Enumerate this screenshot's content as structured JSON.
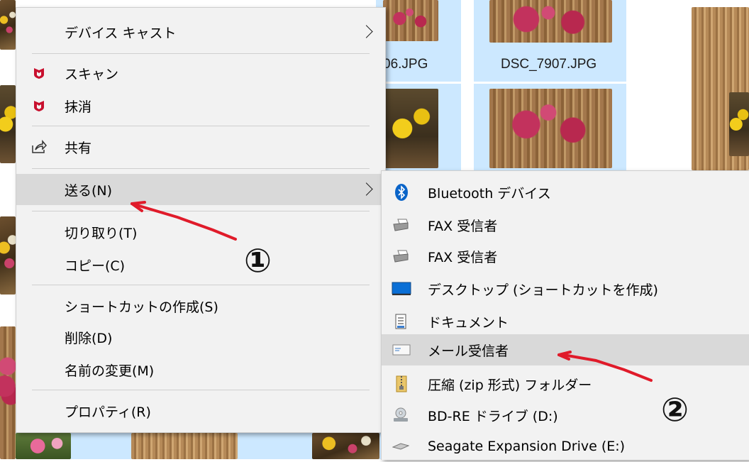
{
  "explorer": {
    "thumbnail_labels": [
      "06.JPG",
      "DSC_7907.JPG"
    ]
  },
  "context_menu": {
    "items": [
      {
        "label": "デバイス キャスト",
        "icon": "",
        "submenu": true
      },
      {
        "label": "スキャン",
        "icon": "mcafee-shield-icon",
        "submenu": false
      },
      {
        "label": "抹消",
        "icon": "mcafee-shield-icon",
        "submenu": false
      },
      {
        "label": "共有",
        "icon": "share-icon",
        "submenu": false
      },
      {
        "label": "送る(N)",
        "icon": "",
        "submenu": true,
        "highlighted": true
      },
      {
        "label": "切り取り(T)",
        "icon": "",
        "submenu": false
      },
      {
        "label": "コピー(C)",
        "icon": "",
        "submenu": false
      },
      {
        "label": "ショートカットの作成(S)",
        "icon": "",
        "submenu": false
      },
      {
        "label": "削除(D)",
        "icon": "",
        "submenu": false
      },
      {
        "label": "名前の変更(M)",
        "icon": "",
        "submenu": false
      },
      {
        "label": "プロパティ(R)",
        "icon": "",
        "submenu": false
      }
    ]
  },
  "send_to_menu": {
    "items": [
      {
        "label": "Bluetooth デバイス",
        "icon": "bluetooth-icon"
      },
      {
        "label": "FAX 受信者",
        "icon": "fax-icon"
      },
      {
        "label": "FAX 受信者",
        "icon": "fax-icon"
      },
      {
        "label": "デスクトップ (ショートカットを作成)",
        "icon": "desktop-icon"
      },
      {
        "label": "ドキュメント",
        "icon": "documents-icon"
      },
      {
        "label": "メール受信者",
        "icon": "mail-icon",
        "highlighted": true
      },
      {
        "label": "圧縮 (zip 形式) フォルダー",
        "icon": "zip-folder-icon"
      },
      {
        "label": "BD-RE ドライブ (D:)",
        "icon": "optical-drive-icon"
      },
      {
        "label": "Seagate Expansion Drive (E:)",
        "icon": "external-drive-icon"
      }
    ]
  },
  "annotations": {
    "step1": "①",
    "step2": "②",
    "arrow_color": "#e01b2a"
  },
  "colors": {
    "menu_bg": "#f2f2f2",
    "highlight": "#d9d9d9",
    "selection": "#cce8ff",
    "mcafee_red": "#c8102e",
    "bluetooth_blue": "#0a64c8"
  }
}
